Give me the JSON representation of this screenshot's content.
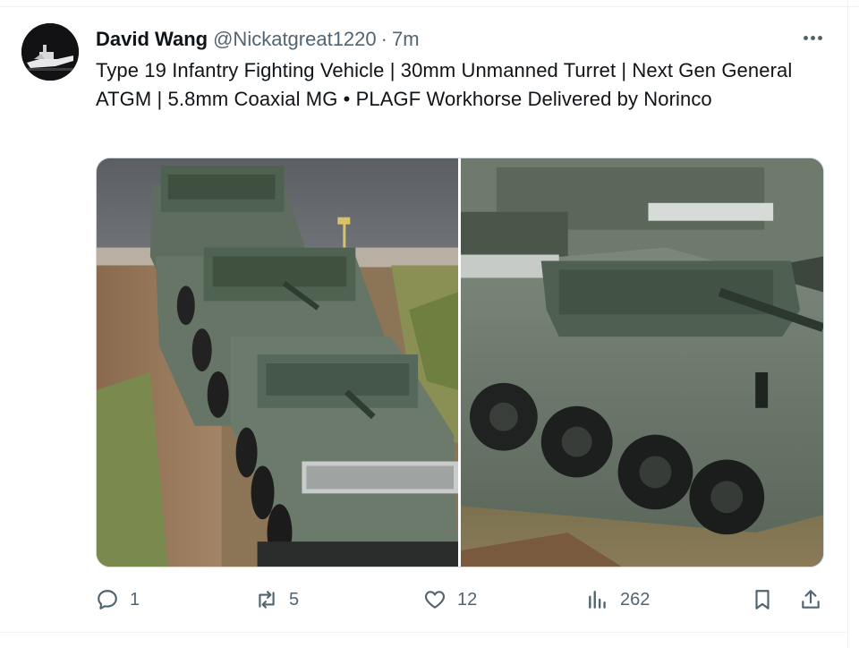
{
  "tweet": {
    "author_name": "David Wang",
    "handle": "@Nickatgreat1220",
    "separator": "·",
    "time": "7m",
    "text": "Type 19 Infantry Fighting Vehicle | 30mm Unmanned Turret | Next Gen General ATGM | 5.8mm Coaxial MG  •  PLAGF Workhorse Delivered by Norinco"
  },
  "actions": {
    "reply_count": "1",
    "retweet_count": "5",
    "like_count": "12",
    "view_count": "262"
  },
  "icons": {
    "more": "more-horizontal-icon",
    "reply": "reply-icon",
    "retweet": "retweet-icon",
    "like": "heart-icon",
    "views": "views-icon",
    "bookmark": "bookmark-icon",
    "share": "share-icon"
  },
  "colors": {
    "text_primary": "#0f1419",
    "text_secondary": "#536471",
    "border": "#cfd9de",
    "vehicle_green": "#5a6b5c"
  }
}
